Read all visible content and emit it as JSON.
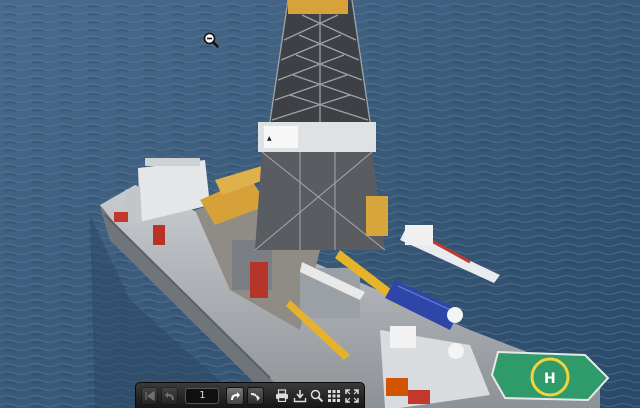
{
  "viewer": {
    "page_number": "1",
    "icons": {
      "zoom_cursor": "zoom-out-magnifier-icon",
      "first": "first-page-icon",
      "undo": "undo-arrow-icon",
      "redo": "redo-arrow-icon",
      "next": "next-page-icon",
      "print": "printer-icon",
      "download": "download-icon",
      "search": "search-icon",
      "thumbnails": "grid-icon",
      "fullscreen": "fullscreen-icon"
    }
  },
  "colors": {
    "sea": "#3b5d7e",
    "helideck": "#2f9a6a",
    "toolbar": "#1e1e1e"
  }
}
